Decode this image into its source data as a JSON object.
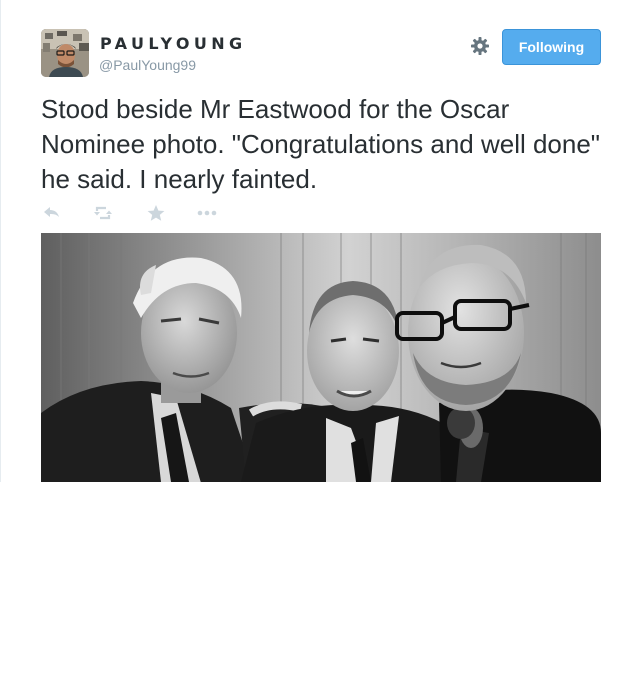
{
  "tweet": {
    "author": {
      "display_name": "PAULYOUNG",
      "handle": "@PaulYoung99",
      "avatar": "avatar-photo"
    },
    "follow_button_label": "Following",
    "settings_icon": "gear-icon",
    "text": "Stood beside Mr Eastwood for the Oscar Nominee photo. \"Congratulations and well done\" he said. I nearly fainted.",
    "actions": {
      "reply_icon": "reply-icon",
      "retweet_icon": "retweet-icon",
      "favorite_icon": "star-icon",
      "more_icon": "more-icon"
    },
    "media": {
      "type": "photo",
      "style": "black-and-white"
    }
  },
  "colors": {
    "follow_button_bg": "#55acee",
    "text": "#292f33",
    "handle": "#8899a6",
    "icon": "#ccd6dd"
  }
}
